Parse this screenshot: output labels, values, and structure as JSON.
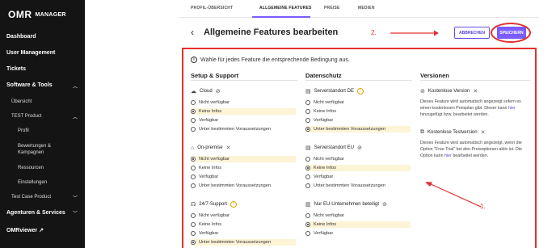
{
  "sidebar": {
    "logo_main": "OMR",
    "logo_sub": "MANAGER",
    "items": [
      {
        "label": "Dashboard"
      },
      {
        "label": "User Management"
      },
      {
        "label": "Tickets"
      },
      {
        "label": "Software & Tools"
      },
      {
        "label": "Übersicht"
      },
      {
        "label": "TEST Product"
      },
      {
        "label": "Profil"
      },
      {
        "label": "Bewertungen & Kampagnen"
      },
      {
        "label": "Ressourcen"
      },
      {
        "label": "Einstellungen"
      },
      {
        "label": "Test Case Product"
      },
      {
        "label": "Agenturen & Services"
      },
      {
        "label": "OMRviewer ↗"
      }
    ]
  },
  "tabs": [
    {
      "label": "PROFIL-ÜBERSICHT"
    },
    {
      "label": "ALLGEMEINE FEATURES"
    },
    {
      "label": "PREISE"
    },
    {
      "label": "MEDIEN"
    }
  ],
  "header": {
    "title": "Allgemeine Features bearbeiten",
    "cancel_label": "ABBRECHEN",
    "save_label": "SPEICHERN"
  },
  "annotations": {
    "step1": "1.",
    "step2": "2."
  },
  "info_text": "Wähle für jedes Feature die entsprechende Bedingung aus.",
  "options": [
    "Nicht verfügbar",
    "Keine Infos",
    "Verfügbar",
    "Unter bestimmten Voraussetzungen"
  ],
  "columns": {
    "setup": {
      "heading": "Setup & Support",
      "features": [
        {
          "name": "Cloud"
        },
        {
          "name": "On-premise"
        },
        {
          "name": "24/7-Support"
        }
      ]
    },
    "datenschutz": {
      "heading": "Datenschutz",
      "features": [
        {
          "name": "Serverstandort DE"
        },
        {
          "name": "Serverstandort EU"
        },
        {
          "name": "Nur EU-Unternehmen beteiligt"
        }
      ]
    },
    "versionen": {
      "heading": "Versionen",
      "features": [
        {
          "name": "Kostenlose Version",
          "desc_a": "Dieses Feature wird automatisch angezeigt sofern es einen kostenlosen Preisplan gibt. Dieser kann ",
          "link": "hier",
          "desc_b": " hinzugefügt bzw. bearbeitet werden."
        },
        {
          "name": "Kostenlose Testversion",
          "desc_a": "Dieses Feature wird automatisch angezeigt, wenn die Option \"Free Trial\" bei den Preisoptionen aktiv ist. Die Option kann ",
          "link": "hier",
          "desc_b": " bearbeitet werden."
        }
      ]
    }
  },
  "colors": {
    "accent": "#7b5cff",
    "annotation": "#e23030",
    "highlight": "#fdf4d6",
    "sidebar": "#141414"
  }
}
